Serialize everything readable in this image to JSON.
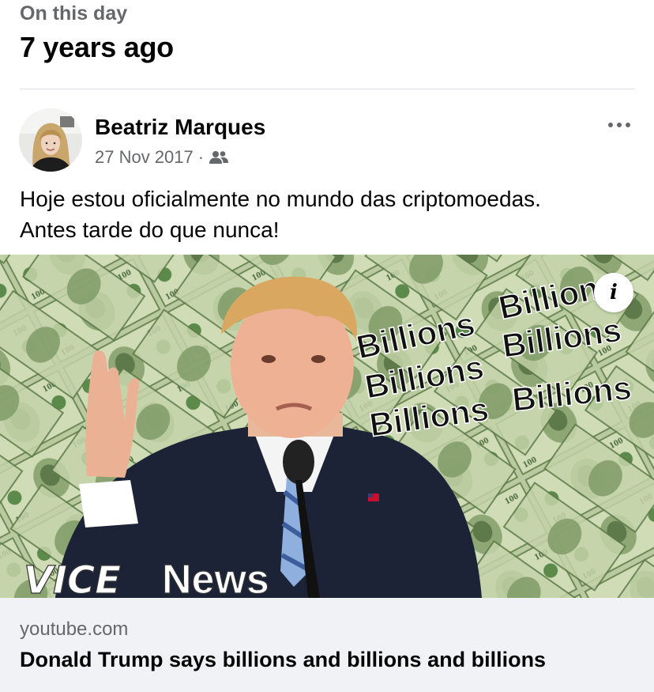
{
  "memories": {
    "section_label": "On this day",
    "years_ago": "7 years ago"
  },
  "post": {
    "author": "Beatriz Marques",
    "date": "27 Nov 2017",
    "separator": "·",
    "audience_icon": "friends-icon",
    "text_lines": [
      "Hoje estou oficialmente no mundo das criptomoedas.",
      "Antes tarde do que nunca!"
    ],
    "more_icon": "more-options-icon"
  },
  "media": {
    "thumbnail_words": [
      "Billions",
      "Billions",
      "Billions",
      "Billions",
      "Billions",
      "Billions"
    ],
    "watermark_brand": "VICE",
    "watermark_suffix": "News",
    "info_icon": "info-icon",
    "info_glyph": "i"
  },
  "link_preview": {
    "domain": "youtube.com",
    "title": "Donald Trump says billions and billions and billions"
  },
  "colors": {
    "primary_text": "#050505",
    "secondary_text": "#65676b",
    "card_background": "#f0f2f5",
    "divider": "#dadde1",
    "money_green": "#8da86a"
  }
}
